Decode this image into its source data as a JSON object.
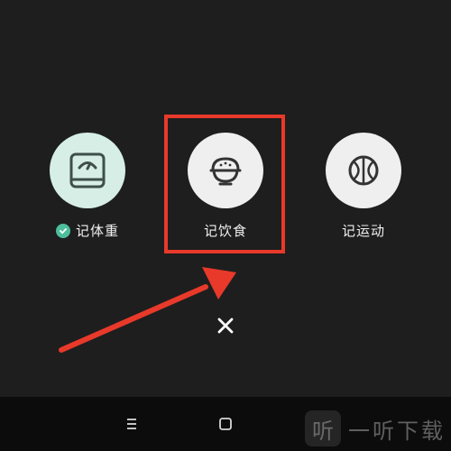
{
  "actions": {
    "weight": {
      "label": "记体重",
      "icon": "scale-icon",
      "recorded": true,
      "bg": "#d6eee6"
    },
    "diet": {
      "label": "记饮食",
      "icon": "rice-bowl-icon",
      "bg": "#efefef"
    },
    "sport": {
      "label": "记运动",
      "icon": "basketball-icon",
      "bg": "#efefef"
    }
  },
  "close": {
    "icon": "close-icon"
  },
  "navbar": {
    "menu_icon": "menu-icon",
    "home_icon": "home-square-icon"
  },
  "watermark": {
    "badge": "听",
    "text": "一听下载"
  },
  "colors": {
    "annotation": "#e8392a",
    "check": "#4dbd9c",
    "background": "#1e1e1e",
    "icon_stroke": "#3f4f4a"
  }
}
